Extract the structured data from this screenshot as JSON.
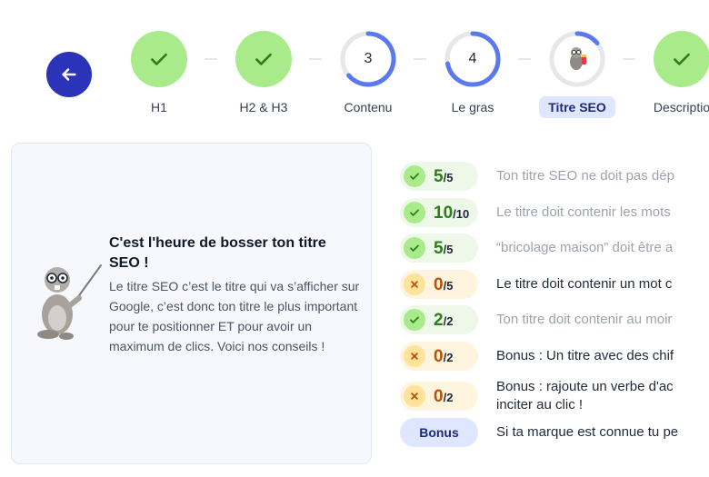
{
  "stepper": {
    "back_label": "",
    "steps": [
      {
        "label": "H1",
        "state": "done"
      },
      {
        "label": "H2 & H3",
        "state": "done"
      },
      {
        "label": "Contenu",
        "state": "progress",
        "number": "3"
      },
      {
        "label": "Le gras",
        "state": "progress",
        "number": "4"
      },
      {
        "label": "Titre SEO",
        "state": "active"
      },
      {
        "label": "Descriptio",
        "state": "done"
      }
    ]
  },
  "card": {
    "title": "C'est l'heure de bosser ton titre SEO !",
    "text": "Le titre SEO c’est le titre qui va s’afficher sur Google, c’est donc ton titre le plus important pour te positionner ET pour avoir un maximum de clics. Voici nos conseils !"
  },
  "criteria": [
    {
      "status": "ok",
      "score": "5",
      "max": "/5",
      "text": "Ton titre SEO ne doit pas dép",
      "tone": "muted"
    },
    {
      "status": "ok",
      "score": "10",
      "max": "/10",
      "text": "Le titre doit contenir les mots",
      "tone": "muted"
    },
    {
      "status": "ok",
      "score": "5",
      "max": "/5",
      "text": "“bricolage maison” doit être a",
      "tone": "muted"
    },
    {
      "status": "ko",
      "score": "0",
      "max": "/5",
      "text": "Le titre doit contenir un mot c",
      "tone": "dark"
    },
    {
      "status": "ok",
      "score": "2",
      "max": "/2",
      "text": "Ton titre doit contenir au moir",
      "tone": "muted"
    },
    {
      "status": "ko",
      "score": "0",
      "max": "/2",
      "text": "Bonus : Un titre avec des chif",
      "tone": "dark"
    },
    {
      "status": "ko",
      "score": "0",
      "max": "/2",
      "text": "Bonus : rajoute un verbe d'ac inciter au clic !",
      "tone": "dark"
    },
    {
      "status": "bonus",
      "score": "Bonus",
      "max": "",
      "text": "Si ta marque est connue tu pe",
      "tone": "dark"
    }
  ],
  "colors": {
    "primary": "#2b33b8",
    "success_bg": "#a9ea8a",
    "warning_bg": "#ffe39a",
    "ring": "#5b79ee",
    "active_tab": "#dfe6ff"
  },
  "icons": {
    "back": "arrow-left-icon",
    "done": "check-icon",
    "fail": "x-icon"
  }
}
